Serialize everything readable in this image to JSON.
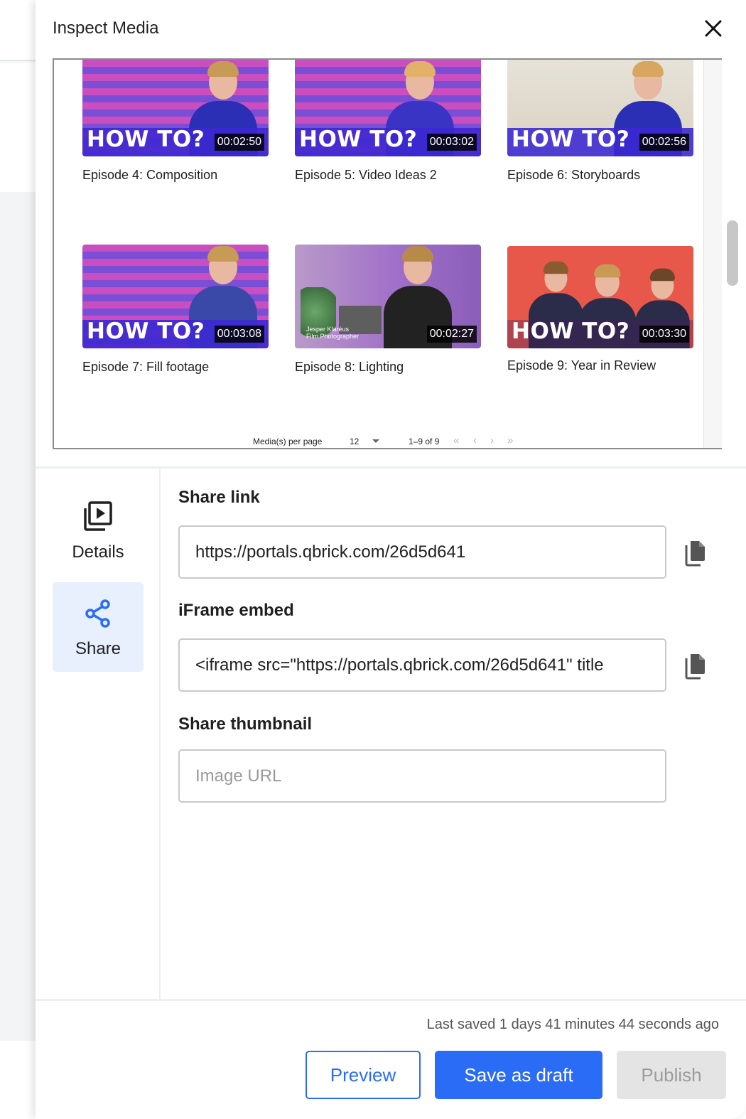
{
  "drawer": {
    "title": "Inspect Media"
  },
  "media": {
    "items": [
      {
        "title": "Episode 4: Composition",
        "duration": "00:02:50",
        "overlay": "HOW TO?"
      },
      {
        "title": "Episode 5: Video Ideas 2",
        "duration": "00:03:02",
        "overlay": "HOW TO?"
      },
      {
        "title": "Episode 6: Storyboards",
        "duration": "00:02:56",
        "overlay": "HOW TO?"
      },
      {
        "title": "Episode 7: Fill footage",
        "duration": "00:03:08",
        "overlay": "HOW TO?"
      },
      {
        "title": "Episode 8: Lighting",
        "duration": "00:02:27",
        "overlay": "",
        "credit_name": "Jesper Klaréus",
        "credit_role": "Film Photographer"
      },
      {
        "title": "Episode 9: Year in Review",
        "duration": "00:03:30",
        "overlay": "HOW TO?"
      }
    ],
    "pager": {
      "per_page_label": "Media(s) per page",
      "per_page_value": "12",
      "range": "1–9 of 9",
      "first": "«",
      "prev": "‹",
      "next": "›",
      "last": "»"
    }
  },
  "side_nav": {
    "items": [
      {
        "label": "Details",
        "icon": "video-library-icon",
        "active": false
      },
      {
        "label": "Share",
        "icon": "share-icon",
        "active": true
      }
    ]
  },
  "share": {
    "link_label": "Share link",
    "link_value": "https://portals.qbrick.com/26d5d641",
    "embed_label": "iFrame embed",
    "embed_value": "<iframe src=\"https://portals.qbrick.com/26d5d641\" title",
    "thumbnail_label": "Share thumbnail",
    "thumbnail_placeholder": "Image URL"
  },
  "footer": {
    "last_saved": "Last saved 1 days 41 minutes 44 seconds ago",
    "preview_label": "Preview",
    "draft_label": "Save as draft",
    "publish_label": "Publish"
  },
  "colors": {
    "primary": "#2b6cf6",
    "active_nav_bg": "#e8effd",
    "disabled_bg": "#e4e4e4"
  }
}
